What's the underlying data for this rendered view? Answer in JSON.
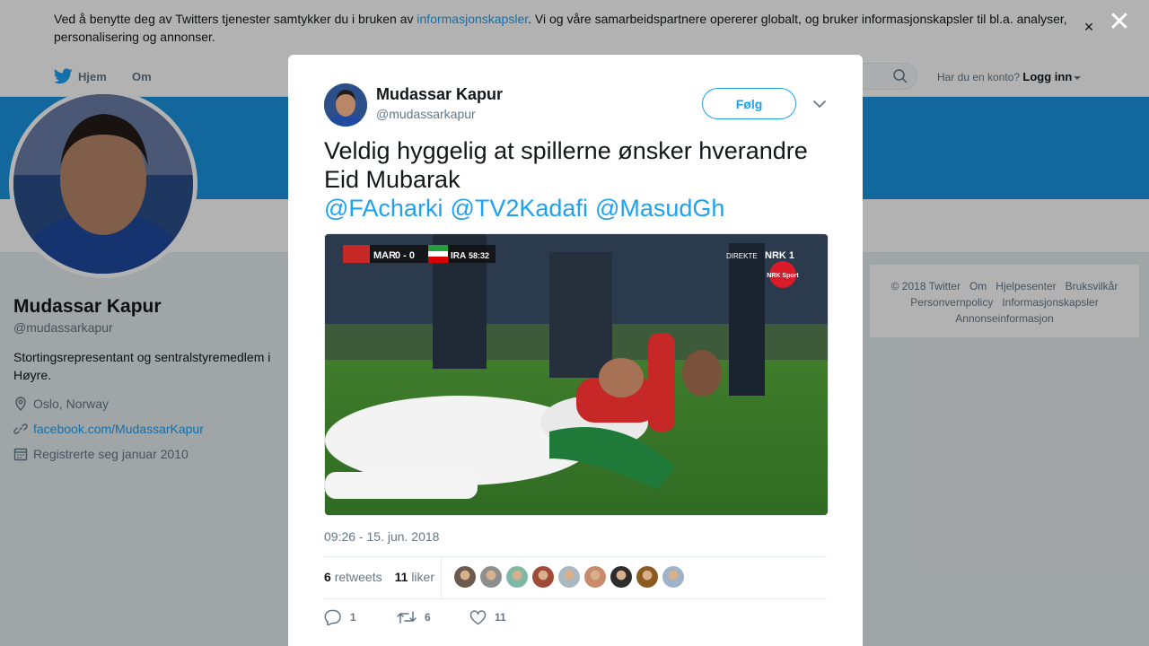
{
  "cookie": {
    "text_before": "Ved å benytte deg av Twitters tjenester samtykker du i bruken av ",
    "link": "informasjonskapsler",
    "text_after": ". Vi og våre samarbeidspartnere opererer globalt, og bruker informasjonskapsler til bl.a. analyser, personalisering og annonser.",
    "close": "×"
  },
  "nav": {
    "home": "Hjem",
    "about": "Om",
    "account_prompt": "Har du en konto?",
    "login": "Logg inn"
  },
  "profile": {
    "name": "Mudassar Kapur",
    "handle": "@mudassarkapur",
    "bio": "Stortingsrepresentant og sentralstyremedlem i Høyre.",
    "location": "Oslo, Norway",
    "website": "facebook.com/MudassarKapur",
    "joined": "Registrerte seg januar 2010"
  },
  "footer": {
    "links": [
      "© 2018 Twitter",
      "Om",
      "Hjelpesenter",
      "Bruksvilkår",
      "Personvernpolicy",
      "Informasjonskapsler",
      "Annonseinformasjon"
    ]
  },
  "overlay": {
    "close": "✕"
  },
  "tweet": {
    "author_name": "Mudassar Kapur",
    "author_handle": "@mudassarkapur",
    "follow_label": "Følg",
    "text": "Veldig hyggelig at spillerne ønsker hverandre Eid Mubarak",
    "mentions": [
      "@FAcharki",
      "@TV2Kadafi",
      "@MasudGh"
    ],
    "media": {
      "scoreboard": {
        "home": "MAR",
        "score": "0 - 0",
        "away": "IRA",
        "clock": "58:32"
      },
      "broadcast_tag": "DIREKTE",
      "channel": "NRK 1",
      "channel_badge": "NRK Sport"
    },
    "timestamp": "09:26 - 15. jun. 2018",
    "retweets_count": "6",
    "retweets_label": "retweets",
    "likes_count": "11",
    "likes_label": "liker",
    "actions": {
      "replies": "1",
      "retweets": "6",
      "likes": "11"
    },
    "liker_face_colors": [
      "#6b5a4e",
      "#8e8e8e",
      "#7fb9a6",
      "#a04a3a",
      "#aab8c2",
      "#c98b6b",
      "#2d2d2d",
      "#8a5a1f",
      "#9fb3c8"
    ]
  },
  "colors": {
    "accent": "#1da1f2",
    "banner": "#1b95e0"
  }
}
